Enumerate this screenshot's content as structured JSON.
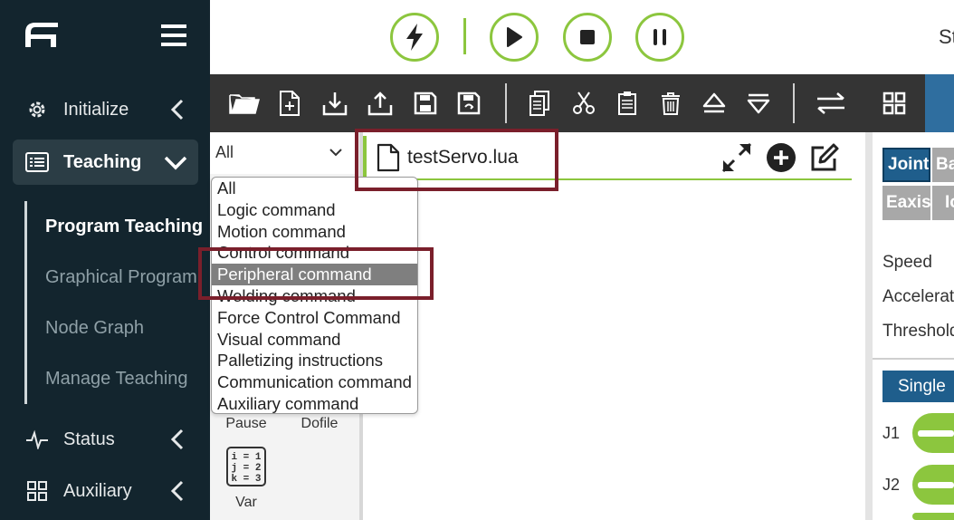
{
  "sidebar": {
    "logo_icon": "brand-logo-icon",
    "menu_icon": "hamburger-icon",
    "items": [
      {
        "label": "Initialize",
        "icon": "gear-icon"
      },
      {
        "label": "Teaching",
        "icon": "list-icon"
      },
      {
        "label": "Status",
        "icon": "pulse-icon"
      },
      {
        "label": "Auxiliary",
        "icon": "grid-icon"
      }
    ],
    "subitems": [
      "Program Teaching",
      "Graphical Program",
      "Node Graph",
      "Manage Teaching"
    ]
  },
  "topbar": {
    "controls": [
      "lightning-icon",
      "play-icon",
      "stop-icon",
      "pause-icon"
    ],
    "status_text": "St"
  },
  "toolbar": {
    "icons": [
      "open-folder-icon",
      "new-file-icon",
      "import-icon",
      "export-icon",
      "save-icon",
      "save-as-icon",
      "copy-icon",
      "cut-icon",
      "paste-icon",
      "delete-icon",
      "move-up-icon",
      "move-down-icon",
      "swap-icon",
      "grid-view-icon"
    ]
  },
  "filter": {
    "selected": "All",
    "options": [
      "All",
      "Logic command",
      "Motion command",
      "Control command",
      "Peripheral command",
      "Welding command",
      "Force Control Command",
      "Visual command",
      "Palletizing instructions",
      "Communication command",
      "Auxiliary command"
    ],
    "highlighted_index": 4
  },
  "commands": [
    {
      "label": "Pause"
    },
    {
      "label": "Dofile"
    },
    {
      "label": "Var",
      "icon_lines": [
        "i = 1",
        "j = 2",
        "k = 3"
      ]
    }
  ],
  "editor": {
    "file_name": "testServo.lua",
    "icons": [
      "expand-icon",
      "add-circle-icon",
      "edit-icon"
    ]
  },
  "right_panel": {
    "mode_buttons": [
      "Joint",
      "Ba",
      "Eaxis",
      "Io"
    ],
    "params": [
      "Speed",
      "Acceleration",
      "Threshold"
    ],
    "single_label": "Single",
    "joints": [
      "J1",
      "J2"
    ]
  },
  "colors": {
    "accent": "#8cc63e",
    "sidebar_bg": "#13252e",
    "toolbar_bg": "#343434",
    "highlight_border": "#7a1f2b",
    "primary_blue": "#1f5e8c"
  }
}
